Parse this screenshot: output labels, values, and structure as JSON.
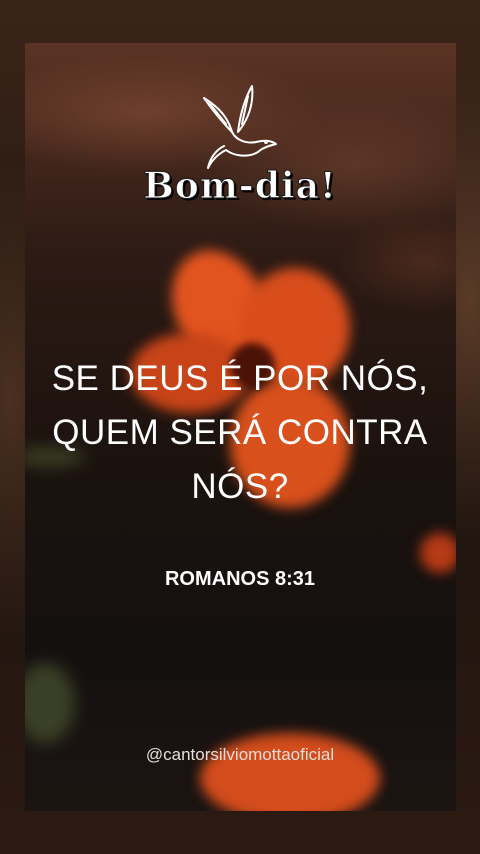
{
  "greeting": "Bom-dia!",
  "verse": {
    "lines": [
      "SE DEUS É POR NÓS,",
      "QUEM SERÁ CONTRA",
      "NÓS?"
    ]
  },
  "reference": "ROMANOS 8:31",
  "handle": "@cantorsilviomottaoficial",
  "icons": {
    "dove": "dove-icon"
  },
  "colors": {
    "flower": "#e2541f",
    "text": "#ffffff",
    "background": "#1b120e"
  }
}
